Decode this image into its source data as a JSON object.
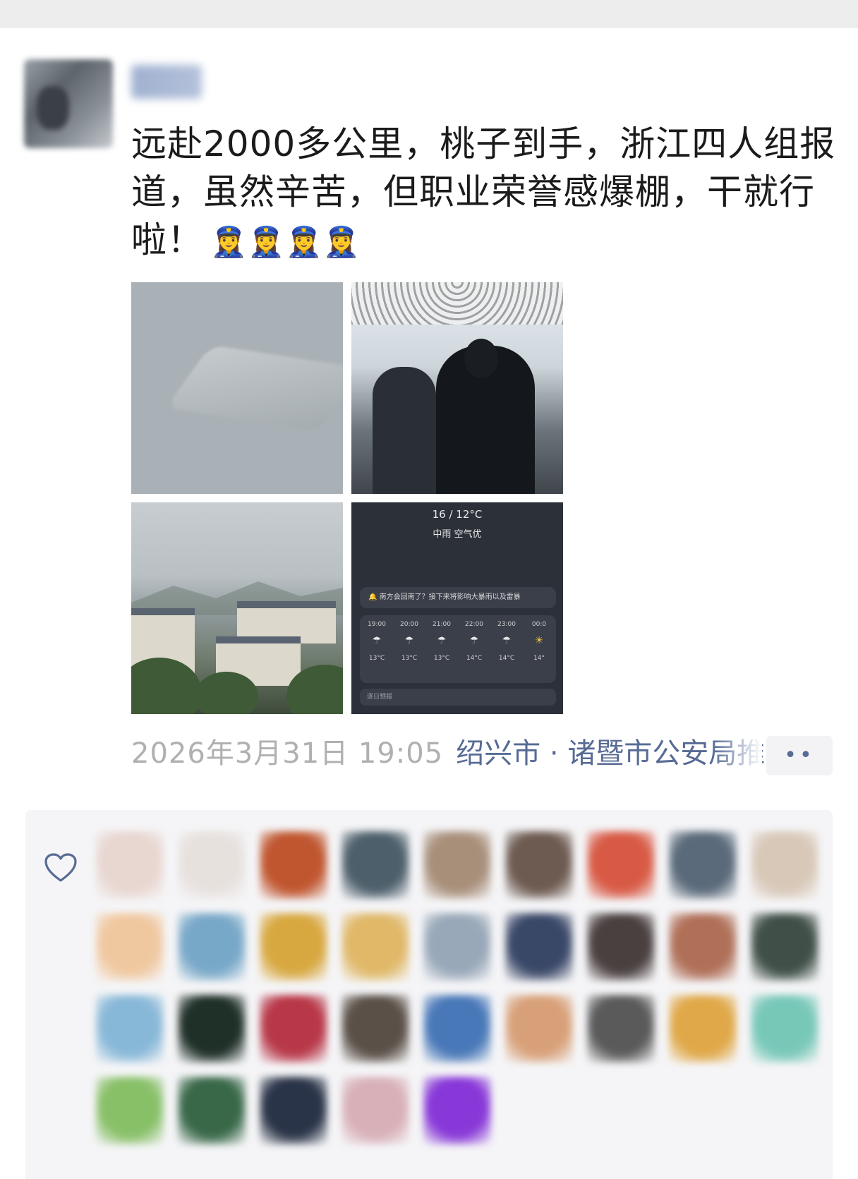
{
  "post": {
    "text": "远赴2000多公里，桃子到手，浙江四人组报道，虽然辛苦，但职业荣誉感爆棚，干就行啦！",
    "emoji": "👮‍♀️👮‍♀️👮‍♀️👮‍♀️",
    "timestamp": "2026年3月31日 19:05",
    "location": "绍兴市 · 诸暨市公安局推",
    "more_icon": "••"
  },
  "weather_card": {
    "temperature": "16 / 12°C",
    "condition": "中雨  空气优",
    "alert": "南方会回南了？接下来将影响大暴雨以及雷暴",
    "hours": [
      {
        "time": "19:00",
        "icon": "cloud-rain-icon",
        "temp": "13°C"
      },
      {
        "time": "20:00",
        "icon": "cloud-rain-icon",
        "temp": "13°C"
      },
      {
        "time": "21:00",
        "icon": "cloud-rain-icon",
        "temp": "13°C"
      },
      {
        "time": "22:00",
        "icon": "cloud-rain-icon",
        "temp": "14°C"
      },
      {
        "time": "23:00",
        "icon": "cloud-rain-icon",
        "temp": "14°C"
      },
      {
        "time": "00:0",
        "icon": "sun-cloud-icon",
        "temp": "14°"
      }
    ],
    "footer": "逐日预报"
  },
  "likes": {
    "icon": "heart-icon",
    "avatar_colors": [
      [
        "#e8d6d0",
        "#e7e1de",
        "#c0562f",
        "#4d5f6b",
        "#a88f7a",
        "#6d5a50",
        "#d85a45",
        "#5a6a7a",
        "#d8c8b8"
      ],
      [
        "#f0c8a0",
        "#78a8c8",
        "#d8a840",
        "#e0b868",
        "#98a8b8",
        "#3a4868",
        "#4a4040",
        "#b07058",
        "#405048"
      ],
      [
        "#88b8d8",
        "#1f3028",
        "#b83848",
        "#5a5048",
        "#4878b8",
        "#d8a078",
        "#5a5a5a",
        "#e0a848",
        "#78c8b8"
      ],
      [
        "#88c068",
        "#386848",
        "#2a3448",
        "#d8b0b8",
        "#8838d8"
      ]
    ]
  }
}
